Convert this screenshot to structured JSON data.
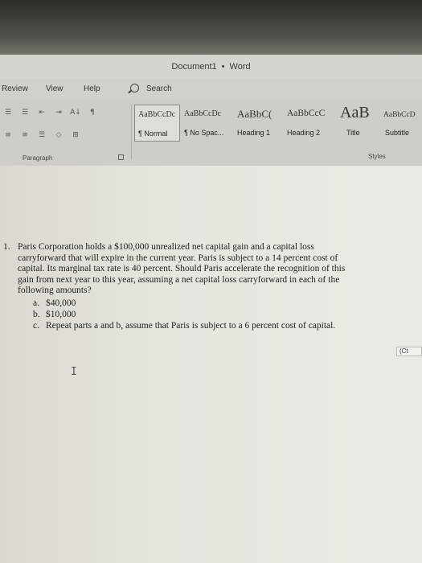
{
  "window": {
    "doc_name": "Document1",
    "separator": "•",
    "app_name": "Word"
  },
  "menu": {
    "tabs": [
      "Review",
      "View",
      "Help"
    ],
    "search_label": "Search"
  },
  "ribbon": {
    "paragraph_label": "Paragraph",
    "styles_label": "Styles",
    "styles": [
      {
        "sample": "AaBbCcDc",
        "name": "¶ Normal"
      },
      {
        "sample": "AaBbCcDc",
        "name": "¶ No Spac..."
      },
      {
        "sample": "AaBbC(",
        "name": "Heading 1"
      },
      {
        "sample": "AaBbCcC",
        "name": "Heading 2"
      },
      {
        "sample": "AaB",
        "name": "Title"
      },
      {
        "sample": "AaBbCcD",
        "name": "Subtitle"
      }
    ],
    "tool_glyphs": {
      "row1": [
        "☰",
        "☰",
        "⇤",
        "⇥",
        "A↓",
        "¶"
      ],
      "row2": [
        "≡",
        "≡",
        "☰",
        "◇",
        "⊞"
      ]
    }
  },
  "document": {
    "question": {
      "number": "1.",
      "lines": [
        "Paris Corporation holds a $100,000 unrealized net capital gain and a capital loss",
        "carryforward that will expire in the current year. Paris is subject to a 14 percent cost of",
        "capital. Its marginal tax rate is 40 percent. Should Paris accelerate the recognition of this",
        "gain from next year to this year, assuming a net capital loss carryforward in each of the",
        "following amounts?"
      ],
      "items": [
        {
          "label": "a.",
          "text": "$40,000"
        },
        {
          "label": "b.",
          "text": "$10,000"
        },
        {
          "label": "c.",
          "text": "Repeat parts a and b, assume that Paris is subject to a 6 percent cost of capital."
        }
      ]
    },
    "paste_options_label": "(Ct"
  },
  "icons": {
    "search": "search-icon",
    "paste": "paste-options-icon",
    "cursor": "ibeam-cursor-icon",
    "launcher": "dialog-launcher-icon"
  }
}
